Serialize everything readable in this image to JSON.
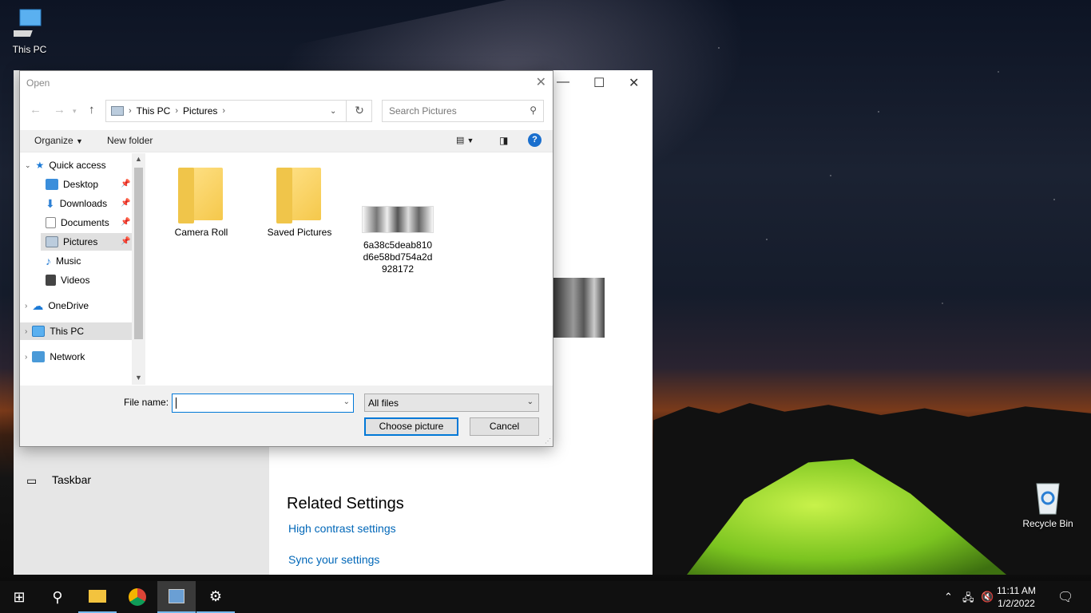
{
  "desktop": {
    "this_pc_label": "This PC",
    "recycle_bin_label": "Recycle Bin"
  },
  "settings_window": {
    "side_item_taskbar": "Taskbar",
    "related_heading": "Related Settings",
    "link_high_contrast": "High contrast settings",
    "link_sync": "Sync your settings"
  },
  "dialog": {
    "title": "Open",
    "breadcrumb": [
      "This PC",
      "Pictures"
    ],
    "search_placeholder": "Search Pictures",
    "toolbar": {
      "organize": "Organize",
      "new_folder": "New folder",
      "help": "?"
    },
    "nav": {
      "quick_access": "Quick access",
      "desktop": "Desktop",
      "downloads": "Downloads",
      "documents": "Documents",
      "pictures": "Pictures",
      "music": "Music",
      "videos": "Videos",
      "onedrive": "OneDrive",
      "this_pc": "This PC",
      "network": "Network"
    },
    "files": [
      {
        "name": "Camera Roll",
        "kind": "folder"
      },
      {
        "name": "Saved Pictures",
        "kind": "folder"
      },
      {
        "name": "6a38c5deab810d6e58bd754a2d928172",
        "kind": "image"
      }
    ],
    "file_name_label": "File name:",
    "file_name_value": "",
    "file_type_value": "All files",
    "choose_button": "Choose picture",
    "cancel_button": "Cancel"
  },
  "taskbar": {
    "time": "11:11 AM",
    "date": "1/2/2022"
  }
}
